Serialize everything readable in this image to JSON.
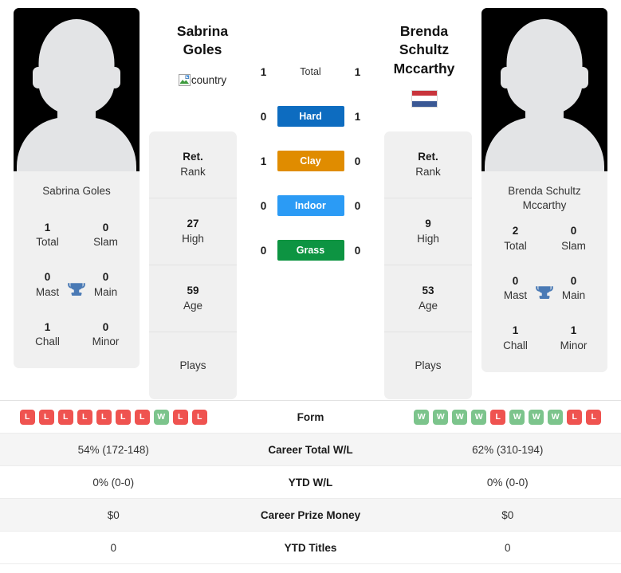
{
  "colors": {
    "hard": "#0d6cc0",
    "clay": "#e08c00",
    "indoor": "#2b9bf5",
    "grass": "#0d9442",
    "win": "#7cc48c",
    "loss": "#ef5350",
    "trophy": "#4a7ab5"
  },
  "left_player": {
    "name_heading": "Sabrina Goles",
    "name_line1": "Sabrina",
    "name_line2": "Goles",
    "photo_caption": "Sabrina Goles",
    "country_image_alt": "country",
    "titles": [
      {
        "num": "1",
        "label": "Total"
      },
      {
        "num": "0",
        "label": "Slam"
      },
      {
        "num": "0",
        "label": "Mast"
      },
      {
        "num": "0",
        "label": "Main"
      },
      {
        "num": "1",
        "label": "Chall"
      },
      {
        "num": "0",
        "label": "Minor"
      }
    ],
    "rank_cells": [
      {
        "num": "Ret.",
        "label": "Rank"
      },
      {
        "num": "27",
        "label": "High"
      },
      {
        "num": "59",
        "label": "Age"
      },
      {
        "num": "",
        "label": "Plays"
      }
    ],
    "form": [
      "L",
      "L",
      "L",
      "L",
      "L",
      "L",
      "L",
      "W",
      "L",
      "L"
    ],
    "career_total_wl": "54% (172-148)",
    "ytd_wl": "0% (0-0)",
    "career_prize_money": "$0",
    "ytd_titles": "0"
  },
  "right_player": {
    "name_heading": "Brenda Schultz Mccarthy",
    "name_line1": "Brenda Schultz",
    "name_line2": "Mccarthy",
    "photo_caption_line1": "Brenda Schultz",
    "photo_caption_line2": "Mccarthy",
    "country_flag": "netherlands-flag",
    "titles": [
      {
        "num": "2",
        "label": "Total"
      },
      {
        "num": "0",
        "label": "Slam"
      },
      {
        "num": "0",
        "label": "Mast"
      },
      {
        "num": "0",
        "label": "Main"
      },
      {
        "num": "1",
        "label": "Chall"
      },
      {
        "num": "1",
        "label": "Minor"
      }
    ],
    "rank_cells": [
      {
        "num": "Ret.",
        "label": "Rank"
      },
      {
        "num": "9",
        "label": "High"
      },
      {
        "num": "53",
        "label": "Age"
      },
      {
        "num": "",
        "label": "Plays"
      }
    ],
    "form": [
      "W",
      "W",
      "W",
      "W",
      "L",
      "W",
      "W",
      "W",
      "L",
      "L"
    ],
    "career_total_wl": "62% (310-194)",
    "ytd_wl": "0% (0-0)",
    "career_prize_money": "$0",
    "ytd_titles": "0"
  },
  "surfaces": [
    {
      "label": "Total",
      "left": "1",
      "right": "1",
      "key": "total"
    },
    {
      "label": "Hard",
      "left": "0",
      "right": "1",
      "key": "hard"
    },
    {
      "label": "Clay",
      "left": "1",
      "right": "0",
      "key": "clay"
    },
    {
      "label": "Indoor",
      "left": "0",
      "right": "0",
      "key": "indoor"
    },
    {
      "label": "Grass",
      "left": "0",
      "right": "0",
      "key": "grass"
    }
  ],
  "table": {
    "form_label": "Form",
    "rows": [
      {
        "label": "Career Total W/L",
        "left": "54% (172-148)",
        "right": "62% (310-194)"
      },
      {
        "label": "YTD W/L",
        "left": "0% (0-0)",
        "right": "0% (0-0)"
      },
      {
        "label": "Career Prize Money",
        "left": "$0",
        "right": "$0"
      },
      {
        "label": "YTD Titles",
        "left": "0",
        "right": "0"
      }
    ]
  }
}
